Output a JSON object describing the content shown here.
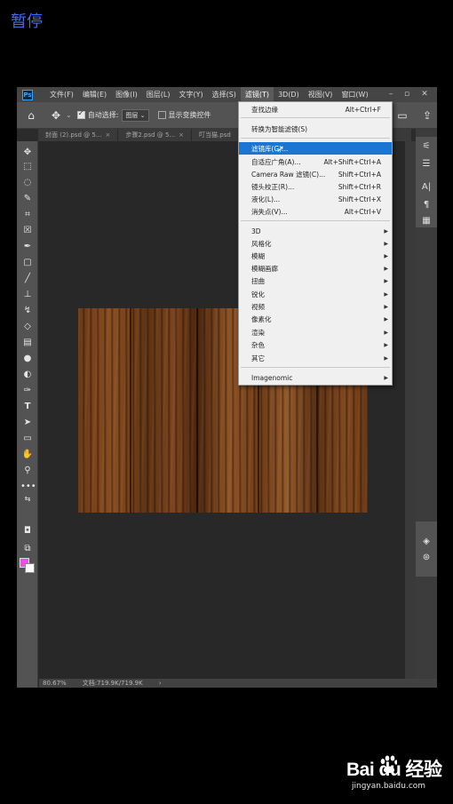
{
  "overlay": {
    "pause_label": "暂停"
  },
  "menubar": {
    "logo": "Ps",
    "items": [
      {
        "label": "文件(F)"
      },
      {
        "label": "编辑(E)"
      },
      {
        "label": "图像(I)"
      },
      {
        "label": "图层(L)"
      },
      {
        "label": "文字(Y)"
      },
      {
        "label": "选择(S)"
      },
      {
        "label": "滤镜(T)"
      },
      {
        "label": "3D(D)"
      },
      {
        "label": "视图(V)"
      },
      {
        "label": "窗口(W)"
      }
    ],
    "active_item": "滤镜(T)"
  },
  "options_bar": {
    "auto_select_label": "自动选择:",
    "auto_select_checked": true,
    "auto_select_value": "图层",
    "show_transform_label": "显示变换控件",
    "show_transform_checked": false
  },
  "tabs": [
    {
      "label": "封面 (2).psd @ 5..."
    },
    {
      "label": "步骤2.psd @ 5..."
    },
    {
      "label": "叮当猫.psd"
    }
  ],
  "filter_menu": {
    "items": [
      {
        "label": "查找边缘",
        "shortcut": "Alt+Ctrl+F"
      },
      {
        "label": "转换为智能滤镜(S)",
        "shortcut": ""
      },
      {
        "label": "滤镜库(G)...",
        "shortcut": "",
        "highlighted": true
      },
      {
        "label": "自适应广角(A)...",
        "shortcut": "Alt+Shift+Ctrl+A"
      },
      {
        "label": "Camera Raw 滤镜(C)...",
        "shortcut": "Shift+Ctrl+A"
      },
      {
        "label": "镜头校正(R)...",
        "shortcut": "Shift+Ctrl+R"
      },
      {
        "label": "液化(L)...",
        "shortcut": "Shift+Ctrl+X"
      },
      {
        "label": "消失点(V)...",
        "shortcut": "Alt+Ctrl+V"
      }
    ],
    "submenus": [
      {
        "label": "3D"
      },
      {
        "label": "风格化"
      },
      {
        "label": "模糊"
      },
      {
        "label": "模糊画廊"
      },
      {
        "label": "扭曲"
      },
      {
        "label": "锐化"
      },
      {
        "label": "视频"
      },
      {
        "label": "像素化"
      },
      {
        "label": "渲染"
      },
      {
        "label": "杂色"
      },
      {
        "label": "其它"
      }
    ],
    "plugins": [
      {
        "label": "Imagenomic"
      }
    ]
  },
  "status": {
    "zoom": "80.67%",
    "doc_info": "文档:719.9K/719.9K"
  },
  "colors": {
    "foreground": "#f04ee6",
    "background": "#ffffff",
    "menu_highlight": "#1a76d2"
  },
  "watermark": {
    "logo": "Bai du 经验",
    "url": "jingyan.baidu.com"
  }
}
